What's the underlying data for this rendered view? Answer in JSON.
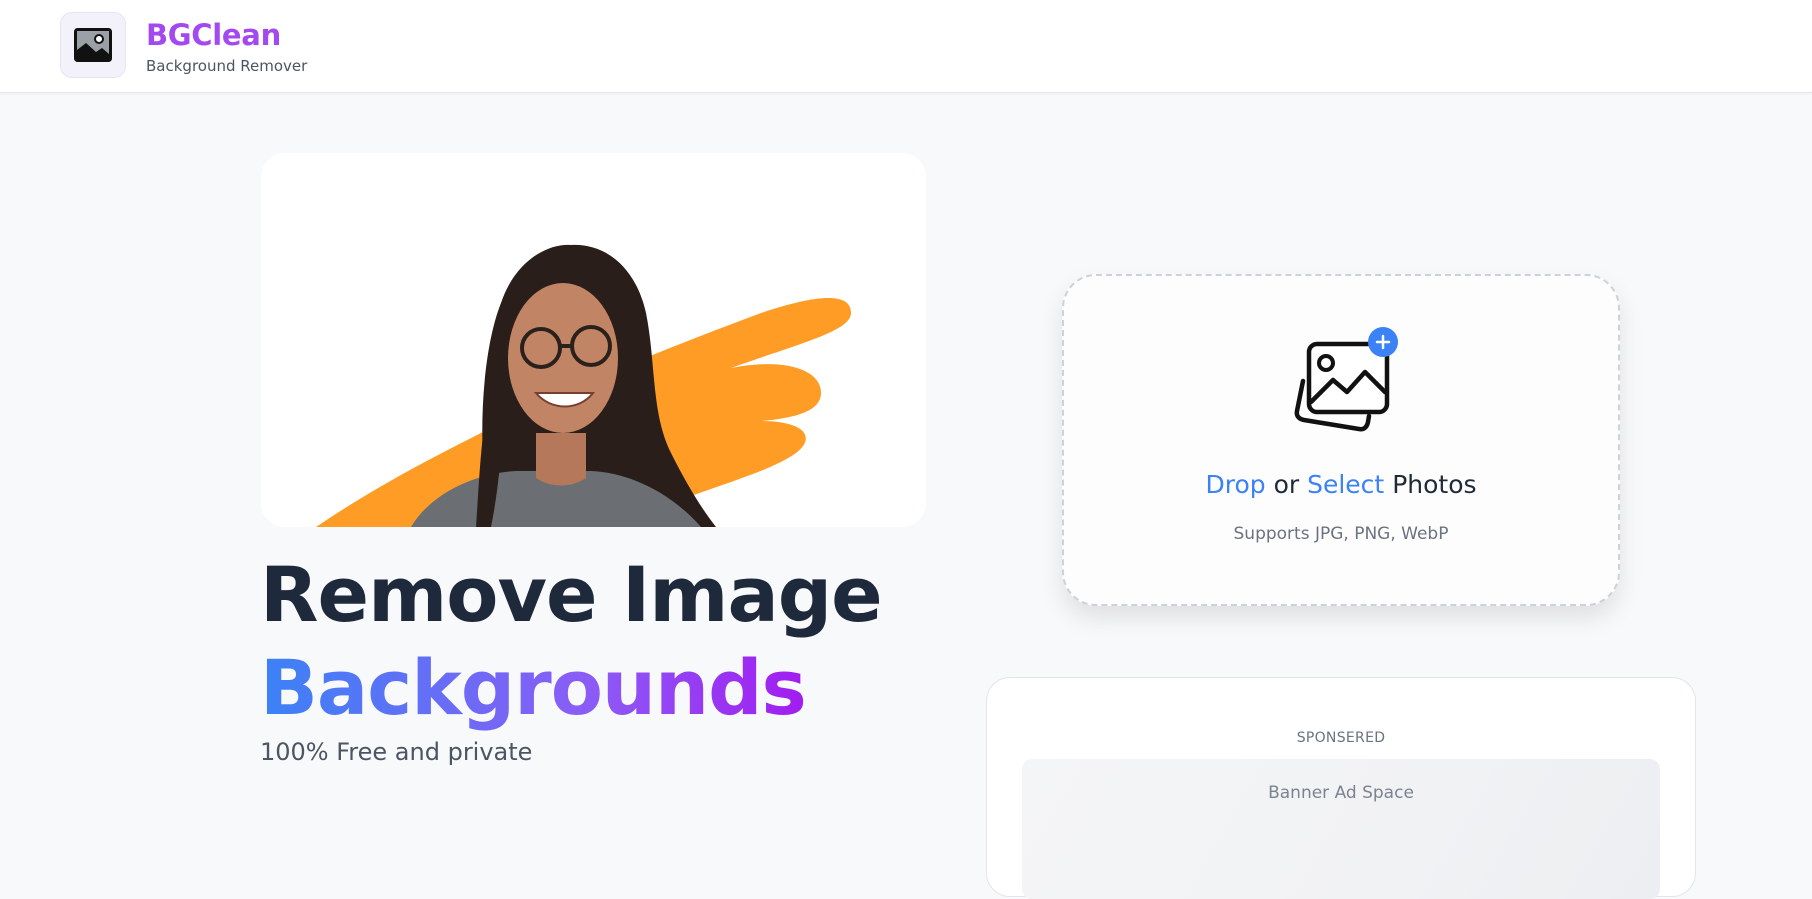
{
  "header": {
    "brand_name": "BGClean",
    "brand_subtitle": "Background Remover",
    "logo_icon": "image-icon"
  },
  "hero": {
    "title_line1": "Remove Image",
    "title_line2": "Backgrounds",
    "tagline": "100% Free and private"
  },
  "upload": {
    "drop_word": "Drop",
    "or_word": "or",
    "select_word": "Select",
    "photos_word": "Photos",
    "hint": "Supports JPG, PNG, WebP",
    "icon": "add-photos-icon"
  },
  "sponsored": {
    "label": "SPONSERED",
    "ad_text": "Banner Ad Space"
  },
  "colors": {
    "brand": "#a349f0",
    "accent": "#3b82f6",
    "brush": "#fe9c25",
    "heading": "#1e293b"
  }
}
